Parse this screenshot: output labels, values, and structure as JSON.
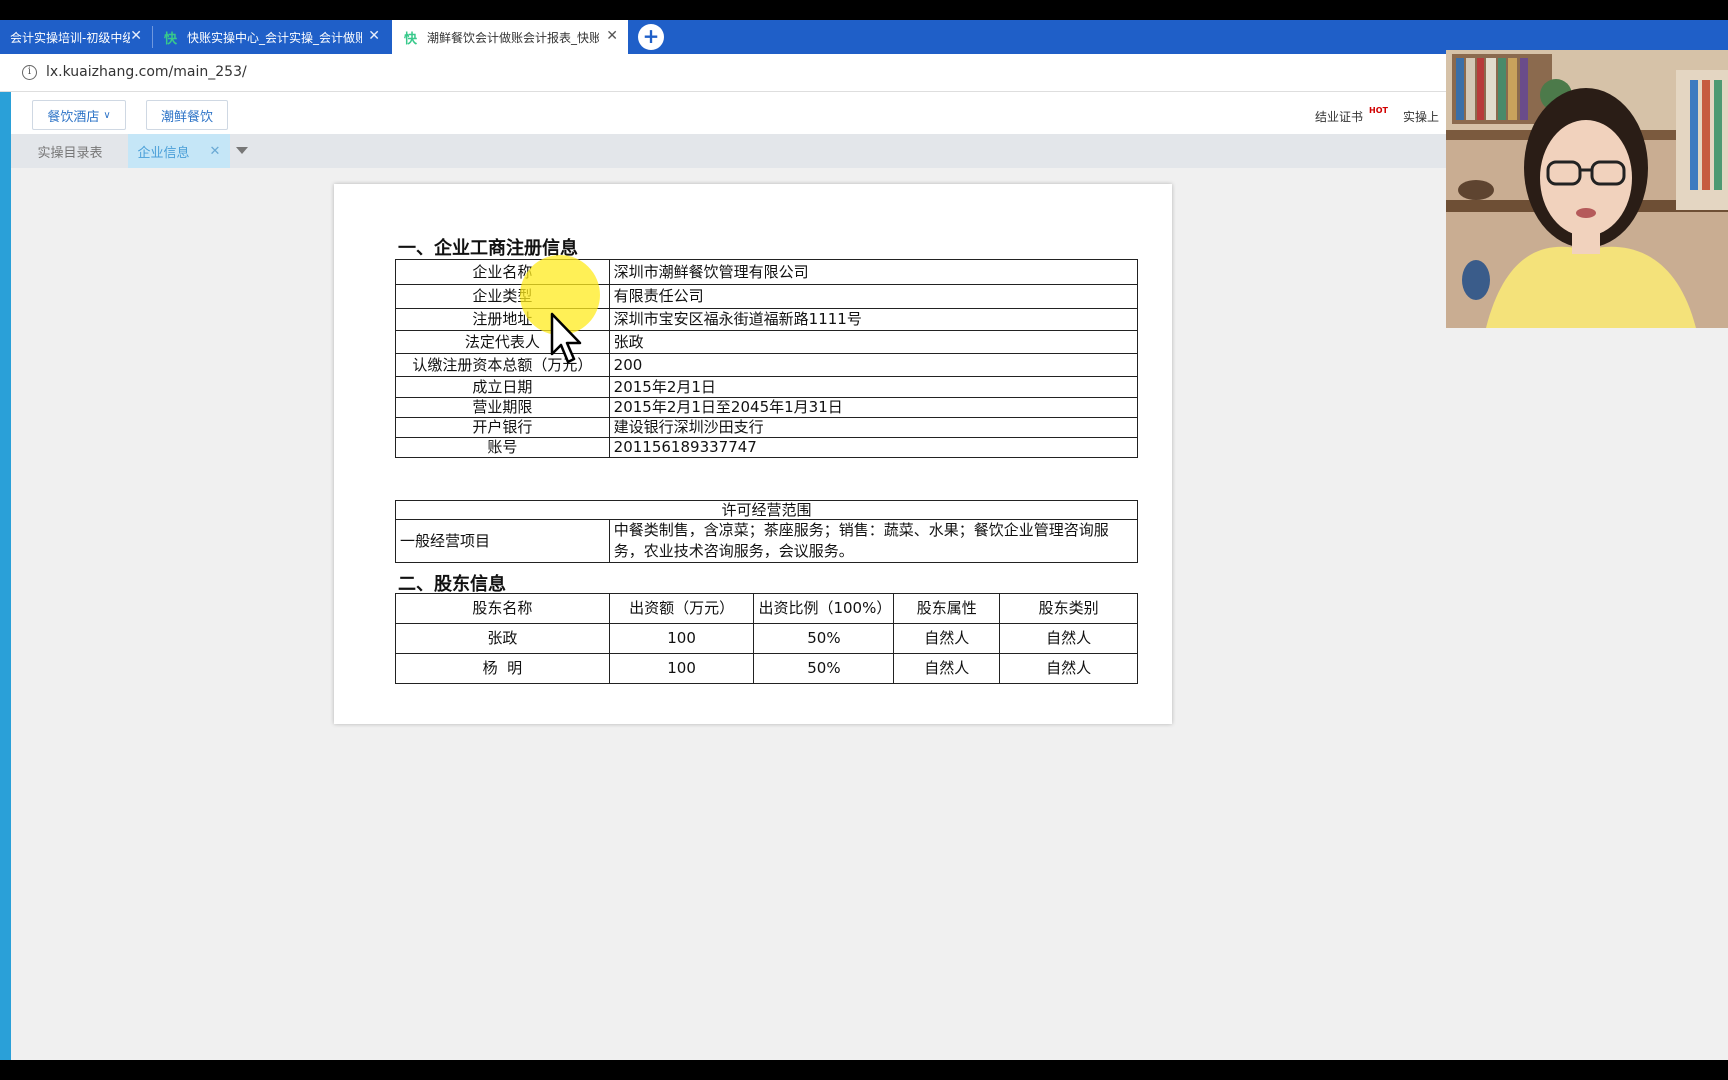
{
  "browser": {
    "tabs": [
      {
        "title": "会计实操培训-初级中级",
        "has_logo": false,
        "active": false
      },
      {
        "title": "快账实操中心_会计实操_会计做账",
        "has_logo": true,
        "active": false
      },
      {
        "title": "潮鲜餐饮会计做账会计报表_快账",
        "has_logo": true,
        "active": true
      }
    ],
    "tab_logo": "快",
    "url": "lx.kuaizhang.com/main_253/"
  },
  "app_header": {
    "industry_select": "餐饮酒店",
    "company_button": "潮鲜餐饮",
    "certificate_link": "结业证书",
    "hot_badge": "HOT",
    "practice_link": "实操上"
  },
  "inner_tabs": [
    {
      "label": "实操目录表",
      "active": false
    },
    {
      "label": "企业信息",
      "active": true
    }
  ],
  "document": {
    "section1_title": "一、企业工商注册信息",
    "registration_rows": [
      {
        "key": "企业名称",
        "value": "深圳市潮鲜餐饮管理有限公司"
      },
      {
        "key": "企业类型",
        "value": "有限责任公司"
      },
      {
        "key": "注册地址",
        "value": "深圳市宝安区福永街道福新路1111号"
      },
      {
        "key": "法定代表人",
        "value": "张政"
      },
      {
        "key": "认缴注册资本总额（万元）",
        "value": "200"
      },
      {
        "key": "成立日期",
        "value": "2015年2月1日"
      },
      {
        "key": "营业期限",
        "value": "2015年2月1日至2045年1月31日"
      },
      {
        "key": "开户银行",
        "value": "建设银行深圳沙田支行"
      },
      {
        "key": "账号",
        "value": "201156189337747"
      }
    ],
    "scope_header": "许可经营范围",
    "scope_key": "一般经营项目",
    "scope_value": "中餐类制售，含凉菜；茶座服务；销售：蔬菜、水果；餐饮企业管理咨询服务，农业技术咨询服务，会议服务。",
    "section2_title": "二、股东信息",
    "shareholder_headers": [
      "股东名称",
      "出资额（万元）",
      "出资比例（100%）",
      "股东属性",
      "股东类别"
    ],
    "shareholders": [
      [
        "张政",
        "100",
        "50%",
        "自然人",
        "自然人"
      ],
      [
        "杨  明",
        "100",
        "50%",
        "自然人",
        "自然人"
      ]
    ]
  },
  "icons": {
    "close": "close-icon",
    "new_tab": "plus-icon",
    "site_info": "info-icon",
    "dropdown": "chevron-down-icon",
    "cursor": "mouse-pointer-icon"
  },
  "colors": {
    "tab_strip": "#1f5fc8",
    "tab_logo": "#38c98b",
    "accent_blue": "#2e74c7",
    "inner_tab_active_bg": "#c5e6f7",
    "left_bar": "#2aa0d8",
    "cursor_highlight": "#ffeb1e"
  }
}
